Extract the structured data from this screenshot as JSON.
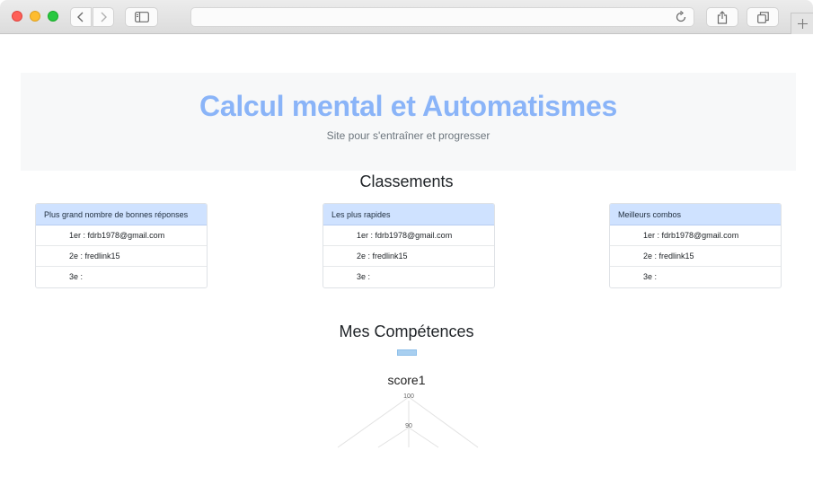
{
  "header": {
    "title": "Calcul mental et Automatismes",
    "subtitle": "Site pour s'entraîner et progresser"
  },
  "classements": {
    "title": "Classements",
    "cards": [
      {
        "header": "Plus grand nombre de bonnes réponses",
        "rows": [
          "1er : fdrb1978@gmail.com",
          "2e : fredlink15",
          "3e :"
        ]
      },
      {
        "header": "Les plus rapides",
        "rows": [
          "1er : fdrb1978@gmail.com",
          "2e : fredlink15",
          "3e :"
        ]
      },
      {
        "header": "Meilleurs combos",
        "rows": [
          "1er : fdrb1978@gmail.com",
          "2e : fredlink15",
          "3e :"
        ]
      }
    ]
  },
  "competences": {
    "title": "Mes Compétences",
    "chart_data": {
      "type": "radar",
      "title": "score1",
      "legend_color": "#a8cff0",
      "tick_labels": [
        "100",
        "90"
      ]
    }
  },
  "colors": {
    "title_blue": "#8ab4f8",
    "card_header_bg": "#cfe2ff",
    "jumbotron_bg": "#f7f8f9"
  }
}
